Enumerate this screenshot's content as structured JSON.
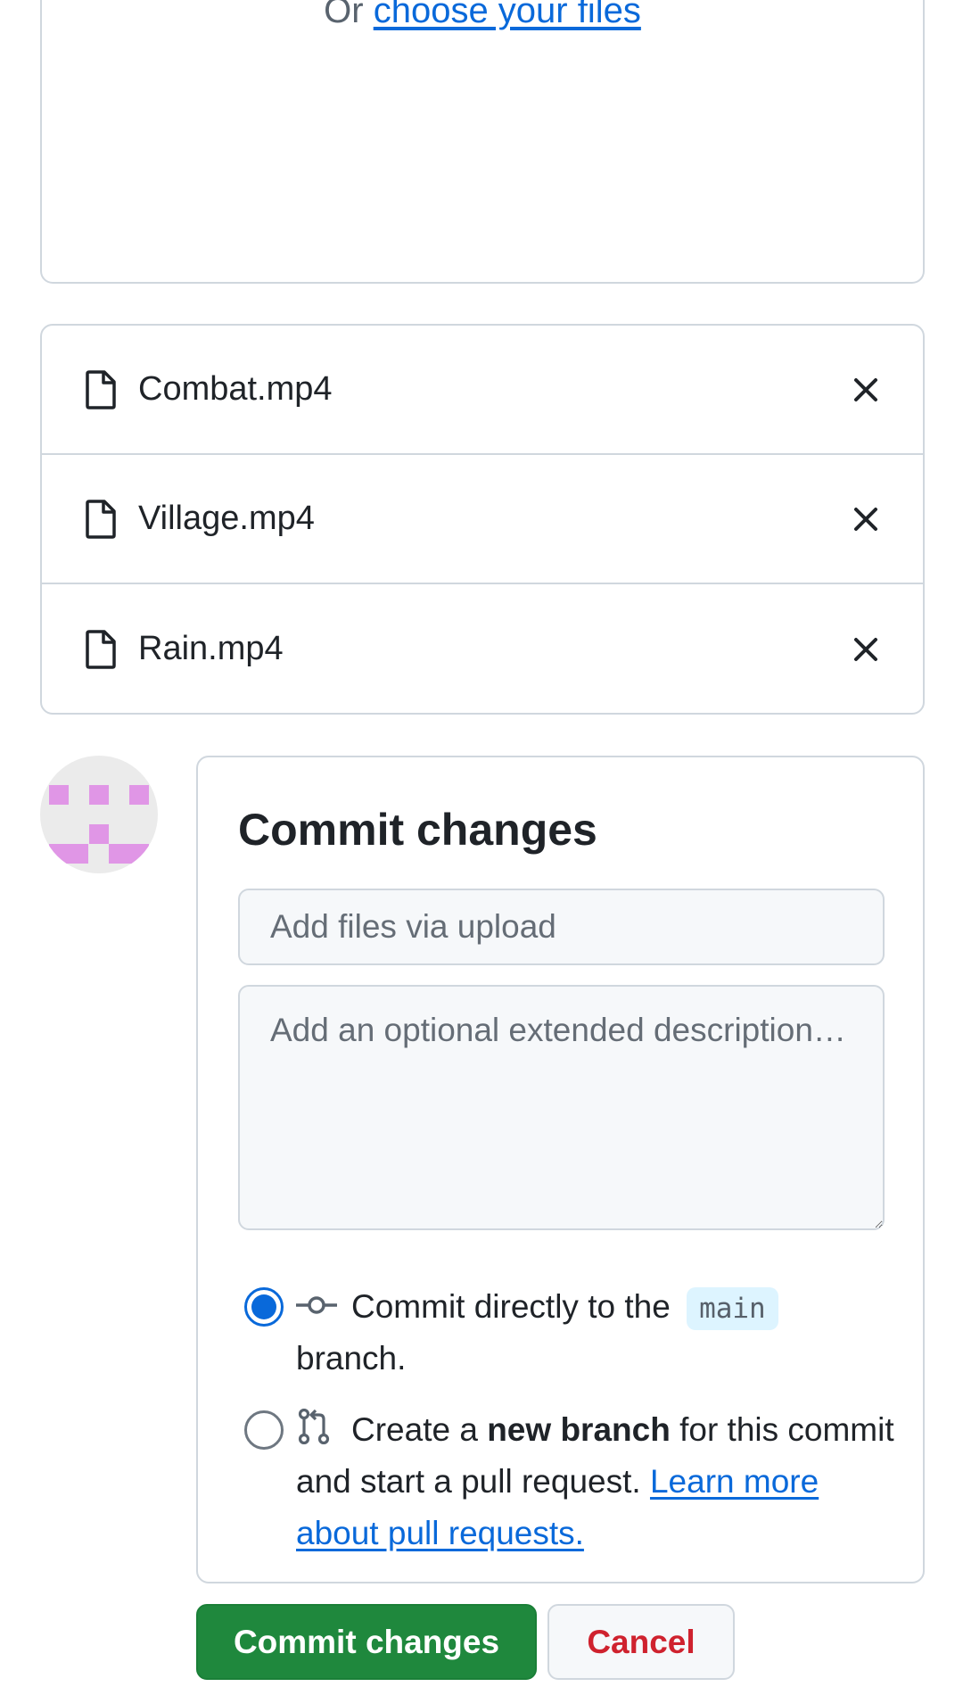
{
  "dropzone": {
    "prefix": "Or",
    "choose_link": "choose your files"
  },
  "files": [
    {
      "name": "Combat.mp4"
    },
    {
      "name": "Village.mp4"
    },
    {
      "name": "Rain.mp4"
    }
  ],
  "commit": {
    "title": "Commit changes",
    "summary_placeholder": "Add files via upload",
    "description_placeholder": "Add an optional extended description…",
    "option_direct": {
      "text_before": "Commit directly to the",
      "branch": "main",
      "text_after": "branch.",
      "selected": true
    },
    "option_new_branch": {
      "text_before": "Create a",
      "bold": "new branch",
      "text_after": "for this commit and start a pull request.",
      "link": "Learn more about pull requests.",
      "selected": false
    }
  },
  "buttons": {
    "commit_label": "Commit changes",
    "cancel_label": "Cancel"
  },
  "colors": {
    "primary_green": "#1f883d",
    "link_blue": "#0969da",
    "danger_red": "#cf222e",
    "avatar_pink": "#e096e6"
  }
}
